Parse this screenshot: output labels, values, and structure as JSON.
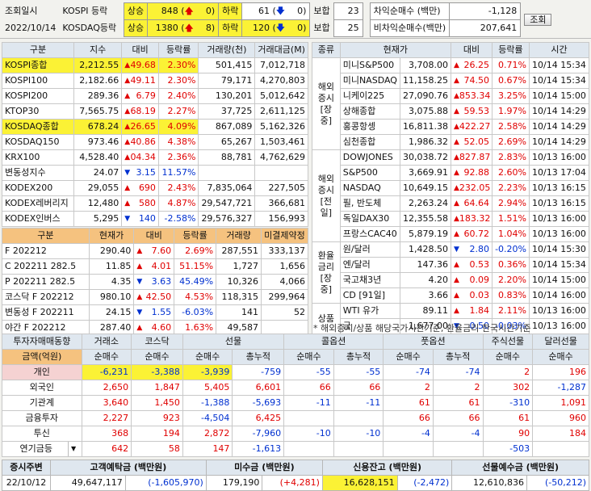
{
  "topbar": {
    "lbl_time": "조회일시",
    "date": "2022/10/14",
    "kospi_label": "KOSPI 등락",
    "kosdaq_label": "KOSDAQ등락",
    "rise": "상승",
    "fall": "하락",
    "flat": "보합",
    "kospi_up": "848",
    "kospi_upper": "0",
    "kospi_down": "61",
    "kospi_lower": "0",
    "kospi_flat": "23",
    "kosdaq_up": "1380",
    "kosdaq_upper": "8",
    "kosdaq_down": "120",
    "kosdaq_lower": "0",
    "kosdaq_flat": "25",
    "arb_label": "차익순매수 (백만)",
    "arb_value": "-1,128",
    "nonarb_label": "비차익순매수(백만)",
    "nonarb_value": "207,641",
    "query_button": "조회"
  },
  "domestic": {
    "headers": [
      "구분",
      "지수",
      "대비",
      "등락률",
      "거래량(천)",
      "거래대금(M)"
    ],
    "rows": [
      {
        "name": "KOSPI종합",
        "value": "2,212.55",
        "chg": "49.68",
        "dir": "up",
        "rate": "2.30%",
        "vol": "501,415",
        "amt": "7,012,718",
        "hl": true
      },
      {
        "name": "KOSPI100",
        "value": "2,182.66",
        "chg": "49.11",
        "dir": "up",
        "rate": "2.30%",
        "vol": "79,171",
        "amt": "4,270,803"
      },
      {
        "name": "KOSPI200",
        "value": "289.36",
        "chg": "6.79",
        "dir": "up",
        "rate": "2.40%",
        "vol": "130,201",
        "amt": "5,012,642"
      },
      {
        "name": "KTOP30",
        "value": "7,565.75",
        "chg": "68.19",
        "dir": "up",
        "rate": "2.27%",
        "vol": "37,725",
        "amt": "2,611,125"
      },
      {
        "name": "KOSDAQ종합",
        "value": "678.24",
        "chg": "26.65",
        "dir": "up",
        "rate": "4.09%",
        "vol": "867,089",
        "amt": "5,162,326",
        "hl": true
      },
      {
        "name": "KOSDAQ150",
        "value": "973.46",
        "chg": "40.86",
        "dir": "up",
        "rate": "4.38%",
        "vol": "65,267",
        "amt": "1,503,461"
      },
      {
        "name": "KRX100",
        "value": "4,528.40",
        "chg": "04.34",
        "dir": "up",
        "rate": "2.36%",
        "vol": "88,781",
        "amt": "4,762,629"
      },
      {
        "name": "변동성지수",
        "value": "24.07",
        "chg": "3.15",
        "dir": "down",
        "rate": "11.57%",
        "vol": "",
        "amt": ""
      },
      {
        "name": "KODEX200",
        "value": "29,055",
        "chg": "690",
        "dir": "up",
        "rate": "2.43%",
        "vol": "7,835,064",
        "amt": "227,505"
      },
      {
        "name": "KODEX레버리지",
        "value": "12,480",
        "chg": "580",
        "dir": "up",
        "rate": "4.87%",
        "vol": "29,547,721",
        "amt": "366,681"
      },
      {
        "name": "KODEX인버스",
        "value": "5,295",
        "chg": "140",
        "dir": "down",
        "rate": "-2.58%",
        "vol": "29,576,327",
        "amt": "156,993"
      }
    ]
  },
  "futures": {
    "headers": [
      "구분",
      "현재가",
      "대비",
      "등락률",
      "거래량",
      "미결제약정"
    ],
    "rows": [
      {
        "name": "F 202212",
        "value": "290.40",
        "chg": "7.60",
        "dir": "up",
        "rate": "2.69%",
        "vol": "287,551",
        "oi": "333,137"
      },
      {
        "name": "C 202211 282.5",
        "value": "11.85",
        "chg": "4.01",
        "dir": "up",
        "rate": "51.15%",
        "vol": "1,727",
        "oi": "1,656"
      },
      {
        "name": "P 202211 282.5",
        "value": "4.35",
        "chg": "3.63",
        "dir": "down",
        "rate": "45.49%",
        "vol": "10,326",
        "oi": "4,066"
      },
      {
        "name": "코스닥 F 202212",
        "value": "980.10",
        "chg": "42.50",
        "dir": "up",
        "rate": "4.53%",
        "vol": "118,315",
        "oi": "299,964"
      },
      {
        "name": "변동성 F 202211",
        "value": "24.15",
        "chg": "1.55",
        "dir": "down",
        "rate": "-6.03%",
        "vol": "141",
        "oi": "52"
      },
      {
        "name": "야간 F 202212",
        "value": "287.40",
        "chg": "4.60",
        "dir": "up",
        "rate": "1.63%",
        "vol": "49,587",
        "oi": ""
      }
    ]
  },
  "overseas": {
    "headers": [
      "종류",
      "",
      "현재가",
      "대비",
      "등락률",
      "시간"
    ],
    "groups": [
      {
        "label": "해외증시[장중]",
        "rows": [
          {
            "name": "미니S&P500",
            "value": "3,708.00",
            "chg": "26.25",
            "dir": "up",
            "rate": "0.71%",
            "time": "10/14 15:34"
          },
          {
            "name": "미니NASDAQ",
            "value": "11,158.25",
            "chg": "74.50",
            "dir": "up",
            "rate": "0.67%",
            "time": "10/14 15:34"
          },
          {
            "name": "니케이225",
            "value": "27,090.76",
            "chg": "853.34",
            "dir": "up",
            "rate": "3.25%",
            "time": "10/14 15:00"
          },
          {
            "name": "상해종합",
            "value": "3,075.88",
            "chg": "59.53",
            "dir": "up",
            "rate": "1.97%",
            "time": "10/14 14:29"
          },
          {
            "name": "홍콩항셍",
            "value": "16,811.38",
            "chg": "422.27",
            "dir": "up",
            "rate": "2.58%",
            "time": "10/14 14:29"
          },
          {
            "name": "심천종합",
            "value": "1,986.32",
            "chg": "52.05",
            "dir": "up",
            "rate": "2.69%",
            "time": "10/14 14:29"
          }
        ]
      },
      {
        "label": "해외증시[전일]",
        "rows": [
          {
            "name": "DOWJONES",
            "value": "30,038.72",
            "chg": "827.87",
            "dir": "up",
            "rate": "2.83%",
            "time": "10/13 16:00"
          },
          {
            "name": "S&P500",
            "value": "3,669.91",
            "chg": "92.88",
            "dir": "up",
            "rate": "2.60%",
            "time": "10/13 17:04"
          },
          {
            "name": "NASDAQ",
            "value": "10,649.15",
            "chg": "232.05",
            "dir": "up",
            "rate": "2.23%",
            "time": "10/13 16:15"
          },
          {
            "name": "필, 반도체",
            "value": "2,263.24",
            "chg": "64.64",
            "dir": "up",
            "rate": "2.94%",
            "time": "10/13 16:15"
          },
          {
            "name": "독일DAX30",
            "value": "12,355.58",
            "chg": "183.32",
            "dir": "up",
            "rate": "1.51%",
            "time": "10/13 16:00"
          },
          {
            "name": "프랑스CAC40",
            "value": "5,879.19",
            "chg": "60.72",
            "dir": "up",
            "rate": "1.04%",
            "time": "10/13 16:00"
          }
        ]
      },
      {
        "label": "환율금리[장중]",
        "rows": [
          {
            "name": "원/달러",
            "value": "1,428.50",
            "chg": "2.80",
            "dir": "down",
            "rate": "-0.20%",
            "time": "10/14 15:30"
          },
          {
            "name": "엔/달러",
            "value": "147.36",
            "chg": "0.53",
            "dir": "up",
            "rate": "0.36%",
            "time": "10/14 15:34"
          },
          {
            "name": "국고채3년",
            "value": "4.20",
            "chg": "0.09",
            "dir": "up",
            "rate": "2.20%",
            "time": "10/14 15:00"
          },
          {
            "name": "CD [91일]",
            "value": "3.66",
            "chg": "0.03",
            "dir": "up",
            "rate": "0.83%",
            "time": "10/14 16:00"
          }
        ]
      },
      {
        "label": "상품",
        "rows": [
          {
            "name": "WTI 유가",
            "value": "89.11",
            "chg": "1.84",
            "dir": "up",
            "rate": "2.11%",
            "time": "10/13 16:00"
          },
          {
            "name": "금",
            "value": "1,677.00",
            "chg": "0.50",
            "dir": "down",
            "rate": "-0.03%",
            "time": "10/13 16:00"
          }
        ]
      }
    ],
    "note": "* 해외증시/상품 해당국가시간기준, 환율금리 한국시간기준"
  },
  "flow": {
    "title": "투자자매매동향",
    "cols": [
      "거래소",
      "코스닥",
      "선물",
      "콜옵션",
      "풋옵션",
      "주식선물",
      "달러선물"
    ],
    "unit": "금액(억원)",
    "subcols": [
      "순매수",
      "순매수",
      "순매수",
      "총누적",
      "순매수",
      "총누적",
      "순매수",
      "총누적",
      "순매수",
      "순매수"
    ],
    "rows": [
      {
        "name": "개인",
        "v": [
          "-6,231",
          "-3,388",
          "-3,939",
          "-759",
          "-55",
          "-55",
          "-74",
          "-74",
          "2",
          "196"
        ],
        "sel": true
      },
      {
        "name": "외국인",
        "v": [
          "2,650",
          "1,847",
          "5,405",
          "6,601",
          "66",
          "66",
          "2",
          "2",
          "302",
          "-1,287"
        ]
      },
      {
        "name": "기관계",
        "v": [
          "3,640",
          "1,450",
          "-1,388",
          "-5,693",
          "-11",
          "-11",
          "61",
          "61",
          "-310",
          "1,091"
        ]
      },
      {
        "name": "금융투자",
        "v": [
          "2,227",
          "923",
          "-4,504",
          "6,425",
          "",
          "",
          "66",
          "66",
          "61",
          "960"
        ]
      },
      {
        "name": "투신",
        "v": [
          "368",
          "194",
          "2,872",
          "-7,960",
          "-10",
          "-10",
          "-4",
          "-4",
          "90",
          "184"
        ]
      },
      {
        "name": "연기금등",
        "v": [
          "642",
          "58",
          "147",
          "-1,613",
          "",
          "",
          "",
          "",
          "-503",
          ""
        ]
      }
    ]
  },
  "bottom": {
    "lbl_trend": "증시주변",
    "date": "22/10/12",
    "deposit_label": "고객예탁금 (백만원)",
    "deposit": "49,647,117",
    "deposit_chg": "-1,605,970",
    "unpaid_label": "미수금 (백만원)",
    "unpaid": "179,190",
    "unpaid_chg": "+4,281",
    "credit_label": "신용잔고 (백만원)",
    "credit": "16,628,151",
    "credit_chg": "-2,472",
    "futdep_label": "선물예수금 (백만원)",
    "futdep": "12,610,836",
    "futdep_chg": "-50,212"
  },
  "colors": {
    "up": "#e00000",
    "down": "#0030d0",
    "highlight": "#fbf235",
    "header": "#dfe7ef"
  }
}
